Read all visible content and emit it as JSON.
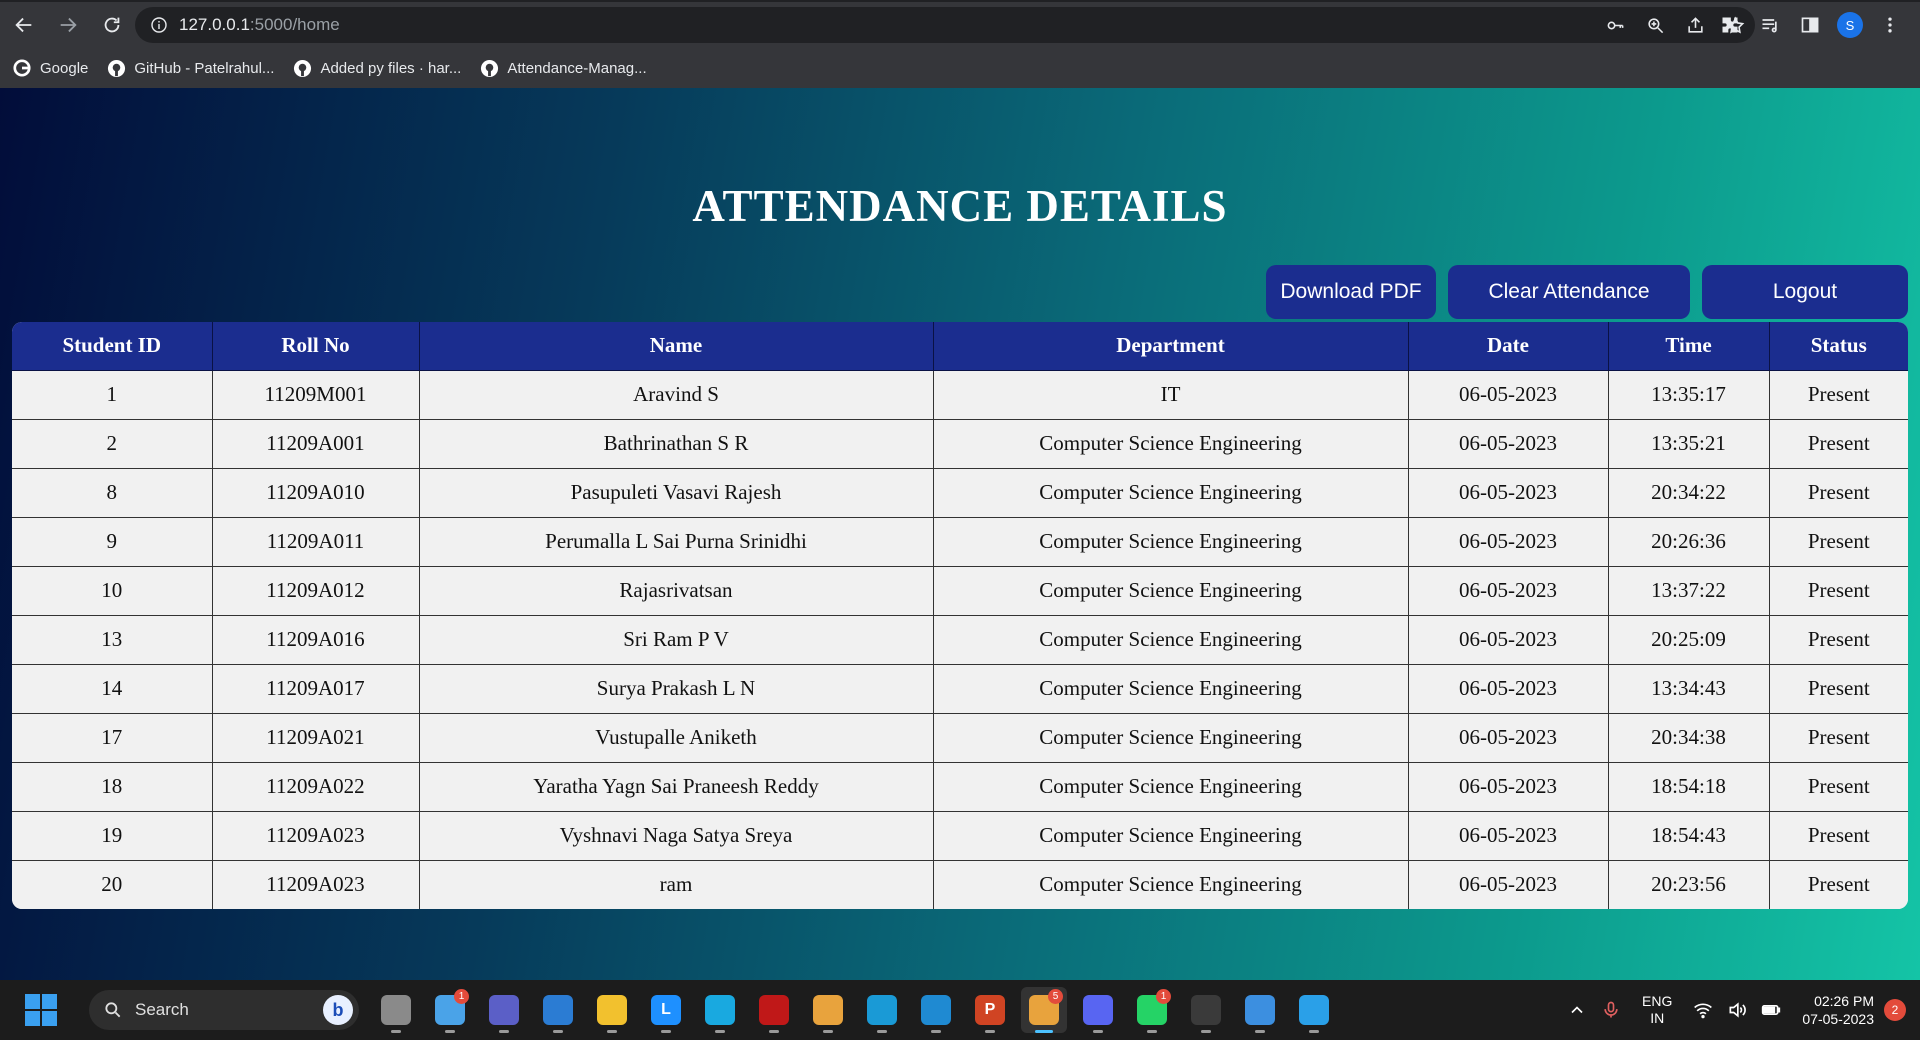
{
  "browser": {
    "url_host": "127.0.0.1",
    "url_path": ":5000/home",
    "profile_initial": "S",
    "bookmarks": [
      {
        "label": "Google",
        "icon": "google-icon"
      },
      {
        "label": "GitHub - Patelrahul...",
        "icon": "github-icon"
      },
      {
        "label": "Added py files · har...",
        "icon": "github-icon"
      },
      {
        "label": "Attendance-Manag...",
        "icon": "github-icon"
      }
    ]
  },
  "page": {
    "title": "ATTENDANCE DETAILS",
    "buttons": {
      "download_pdf": "Download PDF",
      "clear_attendance": "Clear Attendance",
      "logout": "Logout"
    },
    "table": {
      "columns": [
        "Student ID",
        "Roll No",
        "Name",
        "Department",
        "Date",
        "Time",
        "Status"
      ],
      "rows": [
        [
          "1",
          "11209M001",
          "Aravind S",
          "IT",
          "06-05-2023",
          "13:35:17",
          "Present"
        ],
        [
          "2",
          "11209A001",
          "Bathrinathan S R",
          "Computer Science Engineering",
          "06-05-2023",
          "13:35:21",
          "Present"
        ],
        [
          "8",
          "11209A010",
          "Pasupuleti Vasavi Rajesh",
          "Computer Science Engineering",
          "06-05-2023",
          "20:34:22",
          "Present"
        ],
        [
          "9",
          "11209A011",
          "Perumalla L Sai Purna Srinidhi",
          "Computer Science Engineering",
          "06-05-2023",
          "20:26:36",
          "Present"
        ],
        [
          "10",
          "11209A012",
          "Rajasrivatsan",
          "Computer Science Engineering",
          "06-05-2023",
          "13:37:22",
          "Present"
        ],
        [
          "13",
          "11209A016",
          "Sri Ram P V",
          "Computer Science Engineering",
          "06-05-2023",
          "20:25:09",
          "Present"
        ],
        [
          "14",
          "11209A017",
          "Surya Prakash L N",
          "Computer Science Engineering",
          "06-05-2023",
          "13:34:43",
          "Present"
        ],
        [
          "17",
          "11209A021",
          "Vustupalle Aniketh",
          "Computer Science Engineering",
          "06-05-2023",
          "20:34:38",
          "Present"
        ],
        [
          "18",
          "11209A022",
          "Yaratha Yagn Sai Praneesh Reddy",
          "Computer Science Engineering",
          "06-05-2023",
          "18:54:18",
          "Present"
        ],
        [
          "19",
          "11209A023",
          "Vyshnavi Naga Satya Sreya",
          "Computer Science Engineering",
          "06-05-2023",
          "18:54:43",
          "Present"
        ],
        [
          "20",
          "11209A023",
          "ram",
          "Computer Science Engineering",
          "06-05-2023",
          "20:23:56",
          "Present"
        ]
      ]
    }
  },
  "taskbar": {
    "search_label": "Search",
    "bing_letter": "b",
    "apps": [
      {
        "name": "file-explorer-icon",
        "color": "#8a8a8a",
        "letter": ""
      },
      {
        "name": "weather-icon",
        "color": "#4aa3e8",
        "letter": "",
        "badge": "1"
      },
      {
        "name": "teams-icon",
        "color": "#5b5fc7",
        "letter": ""
      },
      {
        "name": "mail-icon",
        "color": "#2b7cd3",
        "letter": ""
      },
      {
        "name": "folder-icon",
        "color": "#f2c12e",
        "letter": ""
      },
      {
        "name": "lark-icon",
        "color": "#1e90ff",
        "letter": "L"
      },
      {
        "name": "cortana-icon",
        "color": "#19a9e0",
        "letter": ""
      },
      {
        "name": "mcafee-icon",
        "color": "#c01818",
        "letter": ""
      },
      {
        "name": "chrome-icon",
        "color": "#e8a33d",
        "letter": ""
      },
      {
        "name": "edge-icon",
        "color": "#1a9ad6",
        "letter": ""
      },
      {
        "name": "vscode-icon",
        "color": "#1f8ad2",
        "letter": ""
      },
      {
        "name": "powerpoint-icon",
        "color": "#d04423",
        "letter": "P"
      },
      {
        "name": "chrome-active-icon",
        "color": "#e8a33d",
        "letter": "",
        "badge": "5",
        "active": true
      },
      {
        "name": "discord-icon",
        "color": "#5865f2",
        "letter": ""
      },
      {
        "name": "whatsapp-icon",
        "color": "#25d366",
        "letter": "",
        "badge": "1"
      },
      {
        "name": "terminal-icon",
        "color": "#3a3a3a",
        "letter": ""
      },
      {
        "name": "photos-icon",
        "color": "#3c8fe0",
        "letter": ""
      },
      {
        "name": "snipping-icon",
        "color": "#2aa0e8",
        "letter": ""
      }
    ],
    "lang_line1": "ENG",
    "lang_line2": "IN",
    "time": "02:26 PM",
    "date": "07-05-2023",
    "notifications": "2"
  }
}
